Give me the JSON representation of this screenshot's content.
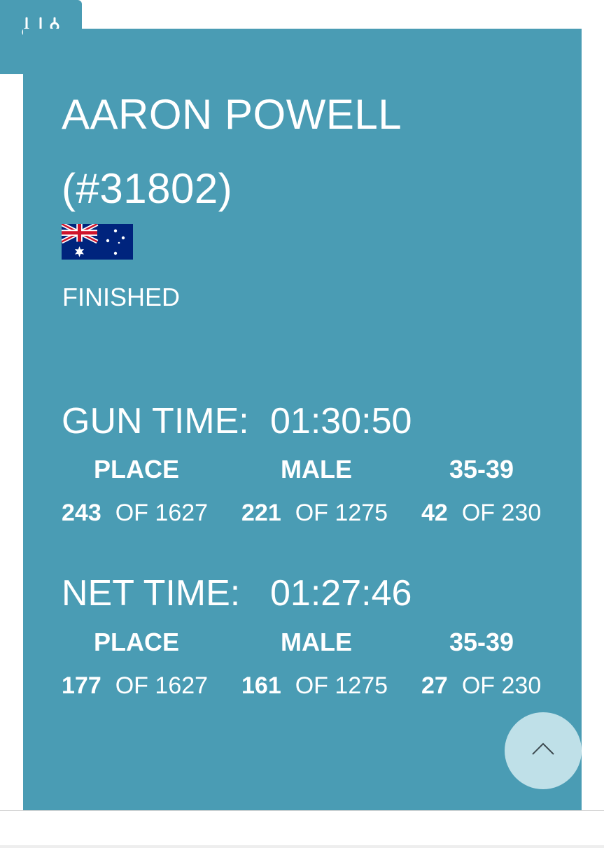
{
  "filter": {
    "icon": "sliders-icon"
  },
  "runner": {
    "name": "AARON POWELL",
    "bib": "(#31802)",
    "country_flag": "australia-flag",
    "status": "FINISHED"
  },
  "gun_time": {
    "label": "GUN TIME:",
    "value": "01:30:50",
    "headers": [
      "PLACE",
      "MALE",
      "35-39"
    ],
    "results": [
      {
        "rank": "243",
        "of_label": "OF",
        "total": "1627"
      },
      {
        "rank": "221",
        "of_label": "OF",
        "total": "1275"
      },
      {
        "rank": "42",
        "of_label": "OF",
        "total": "230"
      }
    ]
  },
  "net_time": {
    "label": "NET TIME:",
    "value": "01:27:46",
    "headers": [
      "PLACE",
      "MALE",
      "35-39"
    ],
    "results": [
      {
        "rank": "177",
        "of_label": "OF",
        "total": "1627"
      },
      {
        "rank": "161",
        "of_label": "OF",
        "total": "1275"
      },
      {
        "rank": "27",
        "of_label": "OF",
        "total": "230"
      }
    ]
  },
  "scroll_top": {
    "icon": "chevron-up-icon"
  },
  "colors": {
    "card": "#4a9cb4",
    "scroll_button": "#bfe0e8",
    "text": "#ffffff"
  }
}
